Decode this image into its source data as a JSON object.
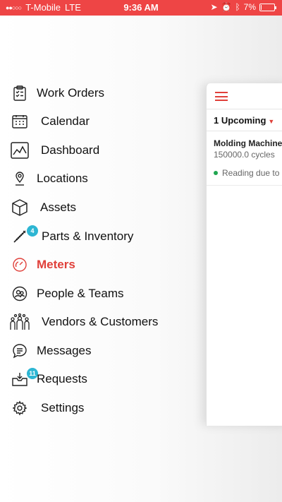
{
  "status_bar": {
    "carrier": "T-Mobile",
    "network": "LTE",
    "time": "9:36 AM",
    "battery": "7%",
    "battery_level": 0.07
  },
  "menu": {
    "items": [
      {
        "label": "Work Orders",
        "icon": "clipboard-checklist-icon"
      },
      {
        "label": "Calendar",
        "icon": "calendar-icon"
      },
      {
        "label": "Dashboard",
        "icon": "chart-icon"
      },
      {
        "label": "Locations",
        "icon": "location-pin-icon"
      },
      {
        "label": "Assets",
        "icon": "cube-icon"
      },
      {
        "label": "Parts & Inventory",
        "icon": "screw-icon",
        "badge": "4"
      },
      {
        "label": "Meters",
        "icon": "gauge-icon",
        "active": true
      },
      {
        "label": "People & Teams",
        "icon": "people-icon"
      },
      {
        "label": "Vendors & Customers",
        "icon": "group-icon"
      },
      {
        "label": "Messages",
        "icon": "chat-bubble-icon"
      },
      {
        "label": "Requests",
        "icon": "inbox-icon",
        "badge": "11"
      },
      {
        "label": "Settings",
        "icon": "gear-icon"
      }
    ]
  },
  "preview": {
    "filter_label": "1 Upcoming",
    "meter": {
      "name": "Molding Machine",
      "value": "150000.0 cycles",
      "status": "Reading due to"
    }
  },
  "colors": {
    "accent": "#e0403a",
    "status_bar": "#ee4545",
    "badge": "#2db6d3",
    "status_green": "#1fa650"
  }
}
